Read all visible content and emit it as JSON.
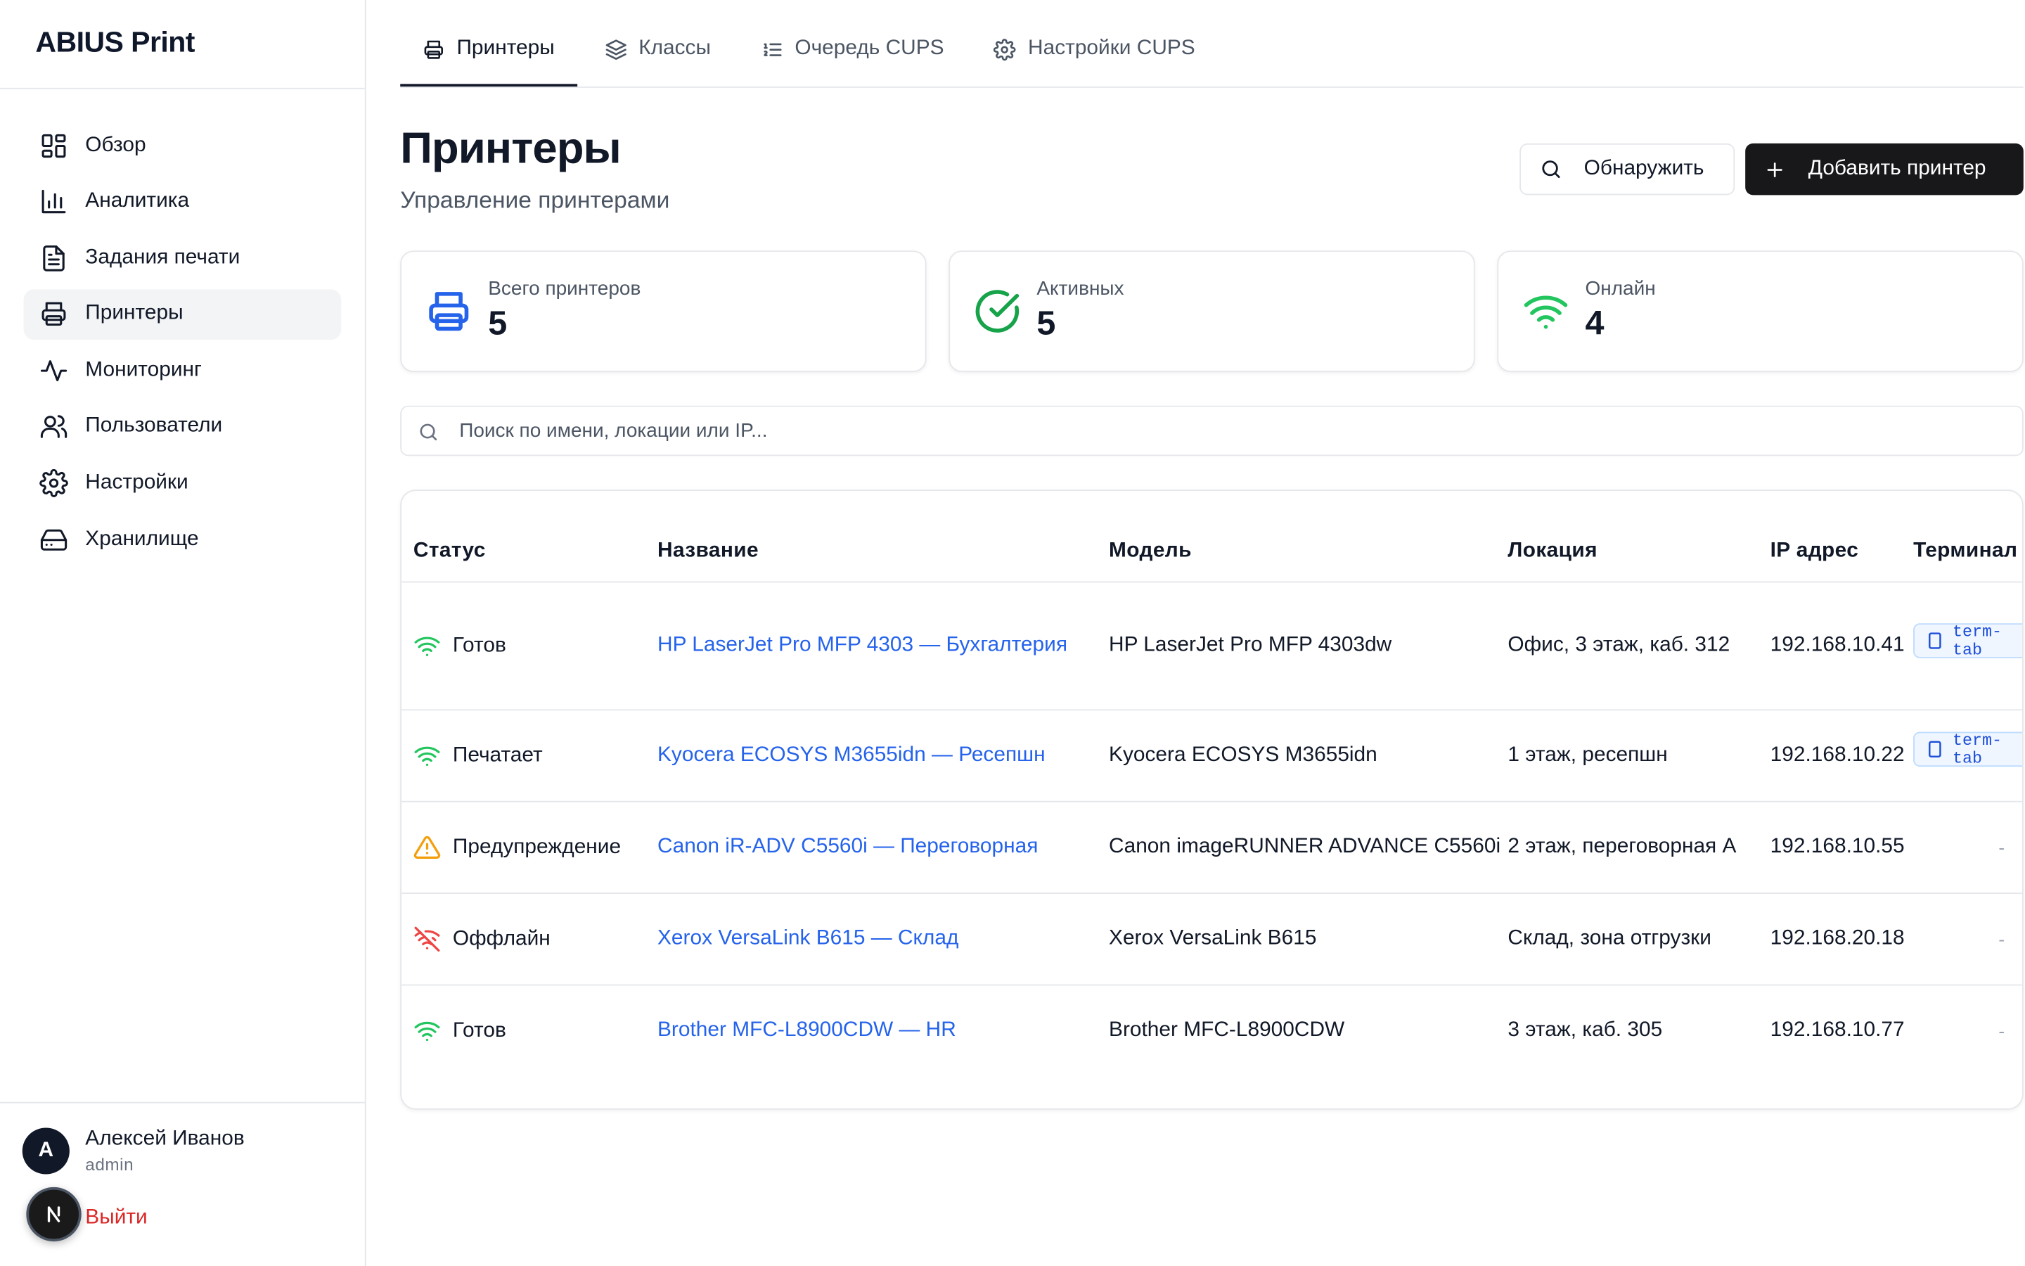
{
  "app": {
    "brand": "ABIUS Print"
  },
  "sidebar": {
    "items": [
      {
        "label": "Обзор",
        "icon": "dashboard-icon",
        "active": false
      },
      {
        "label": "Аналитика",
        "icon": "bar-chart-icon",
        "active": false
      },
      {
        "label": "Задания печати",
        "icon": "document-icon",
        "active": false
      },
      {
        "label": "Принтеры",
        "icon": "printer-icon",
        "active": true
      },
      {
        "label": "Мониторинг",
        "icon": "activity-icon",
        "active": false
      },
      {
        "label": "Пользователи",
        "icon": "users-icon",
        "active": false
      },
      {
        "label": "Настройки",
        "icon": "gear-icon",
        "active": false
      },
      {
        "label": "Хранилище",
        "icon": "hard-drive-icon",
        "active": false
      }
    ],
    "user": {
      "initial": "А",
      "name": "Алексей Иванов",
      "role": "admin",
      "logout": "Выйти",
      "badge": "N"
    }
  },
  "tabs": [
    {
      "label": "Принтеры",
      "icon": "printer-icon",
      "active": true
    },
    {
      "label": "Классы",
      "icon": "layers-icon",
      "active": false
    },
    {
      "label": "Очередь CUPS",
      "icon": "list-ordered-icon",
      "active": false
    },
    {
      "label": "Настройки CUPS",
      "icon": "gear-icon",
      "active": false
    }
  ],
  "header": {
    "title": "Принтеры",
    "subtitle": "Управление принтерами",
    "discover_label": "Обнаружить",
    "add_label": "Добавить принтер"
  },
  "stats": [
    {
      "label": "Всего принтеров",
      "value": "5",
      "icon": "printer-icon",
      "color": "#2563eb"
    },
    {
      "label": "Активных",
      "value": "5",
      "icon": "check-circle-icon",
      "color": "#16a34a"
    },
    {
      "label": "Онлайн",
      "value": "4",
      "icon": "wifi-icon",
      "color": "#22c55e"
    }
  ],
  "search": {
    "placeholder": "Поиск по имени, локации или IP..."
  },
  "table": {
    "columns": [
      "Статус",
      "Название",
      "Модель",
      "Локация",
      "IP адрес",
      "Терминал"
    ],
    "rows": [
      {
        "status": "Готов",
        "status_icon": "wifi-icon",
        "status_color": "#22c55e",
        "name": "HP LaserJet Pro MFP 4303 — Бухгалтерия",
        "model": "HP LaserJet Pro MFP 4303dw",
        "location": "Офис, 3 этаж, каб. 312",
        "ip": "192.168.10.41",
        "terminal": "term-tab"
      },
      {
        "status": "Печатает",
        "status_icon": "wifi-icon",
        "status_color": "#22c55e",
        "name": "Kyocera ECOSYS M3655idn — Ресепшн",
        "model": "Kyocera ECOSYS M3655idn",
        "location": "1 этаж, ресепшн",
        "ip": "192.168.10.22",
        "terminal": "term-tab"
      },
      {
        "status": "Предупреждение",
        "status_icon": "warning-icon",
        "status_color": "#f59e0b",
        "name": "Canon iR-ADV C5560i — Переговорная",
        "model": "Canon imageRUNNER ADVANCE C5560i",
        "location": "2 этаж, переговорная А",
        "ip": "192.168.10.55",
        "terminal": "-"
      },
      {
        "status": "Оффлайн",
        "status_icon": "wifi-off-icon",
        "status_color": "#ef4444",
        "name": "Xerox VersaLink B615 — Склад",
        "model": "Xerox VersaLink B615",
        "location": "Склад, зона отгрузки",
        "ip": "192.168.20.18",
        "terminal": "-"
      },
      {
        "status": "Готов",
        "status_icon": "wifi-icon",
        "status_color": "#22c55e",
        "name": "Brother MFC-L8900CDW — HR",
        "model": "Brother MFC-L8900CDW",
        "location": "3 этаж, каб. 305",
        "ip": "192.168.10.77",
        "terminal": "-"
      }
    ]
  }
}
